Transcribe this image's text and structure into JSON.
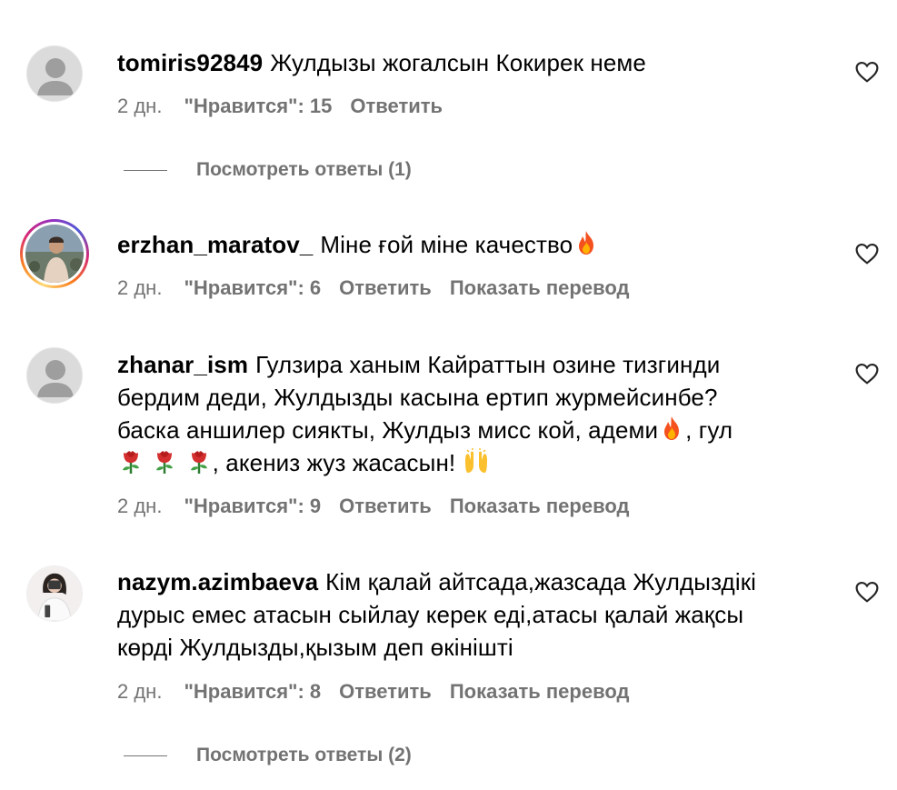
{
  "comments": [
    {
      "username": "tomiris92849",
      "text": "Жулдызы жогалсын Кокирек неме",
      "age": "2 дн.",
      "likes": "\"Нравится\": 15",
      "reply": "Ответить",
      "view_replies": "Посмотреть ответы (1)"
    },
    {
      "username": "erzhan_maratov_",
      "text": "Міне ғой міне качество",
      "age": "2 дн.",
      "likes": "\"Нравится\": 6",
      "reply": "Ответить",
      "translate": "Показать перевод"
    },
    {
      "username": "zhanar_ism",
      "text_line1": "Гулзира ханым Кайраттын озине тизгинди",
      "text_line2": "бердим деди, Жулдызды касына ертип журмейсинбе?",
      "text_line3a": "баска аншилер сиякты, Жулдыз мисс кой, адеми",
      "text_line3b": ", гул",
      "text_line4": ", акениз жуз жасасын!",
      "age": "2 дн.",
      "likes": "\"Нравится\": 9",
      "reply": "Ответить",
      "translate": "Показать перевод"
    },
    {
      "username": "nazym.azimbaeva",
      "text_line1": "Кім қалай айтсада,жазсада Жулдыздікі",
      "text_line2": "дурыс емес атасын сыйлау керек еді,атасы қалай жақсы",
      "text_line3": "көрді Жулдызды,қызым деп өкінішті",
      "age": "2 дн.",
      "likes": "\"Нравится\": 8",
      "reply": "Ответить",
      "translate": "Показать перевод",
      "view_replies": "Посмотреть ответы (2)"
    }
  ],
  "icons": {
    "heart": "heart-outline-icon",
    "fire": "fire-emoji",
    "rose": "rose-emoji",
    "raised_hands": "raised-hands-emoji"
  },
  "colors": {
    "text": "#000000",
    "secondary": "#737373",
    "avatar_placeholder": "#dbdbdb"
  }
}
